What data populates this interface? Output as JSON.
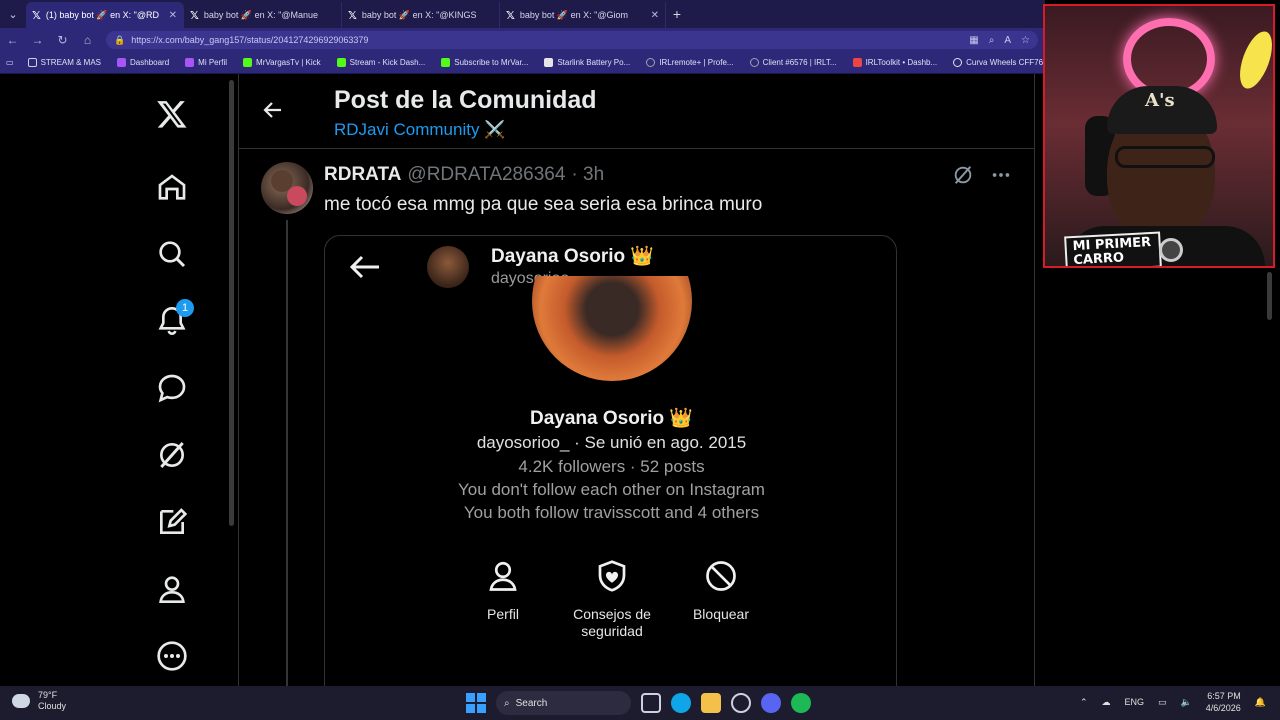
{
  "browser": {
    "tabs": [
      {
        "label": "(1) baby bot 🚀 en X: \"@RD",
        "active": true
      },
      {
        "label": "baby bot 🚀 en X: \"@Manue",
        "active": false
      },
      {
        "label": "baby bot 🚀 en X: \"@KINGS",
        "active": false
      },
      {
        "label": "baby bot 🚀 en X: \"@Giom",
        "active": false
      }
    ],
    "url": "https://x.com/baby_gang157/status/2041274296929063379",
    "bookmarks": [
      {
        "label": "STREAM & MAS",
        "color": "#cfcfe0"
      },
      {
        "label": "Dashboard",
        "color": "#a855f7"
      },
      {
        "label": "Mi Perfil",
        "color": "#a855f7"
      },
      {
        "label": "MrVargasTv | Kick",
        "color": "#53fc18"
      },
      {
        "label": "Stream - Kick Dash...",
        "color": "#53fc18"
      },
      {
        "label": "Subscribe to MrVar...",
        "color": "#53fc18"
      },
      {
        "label": "Starlink Battery Po...",
        "color": "#e5e5e5"
      },
      {
        "label": "IRLremote+ | Profe...",
        "color": "#9ca3af"
      },
      {
        "label": "Client #6576 | IRLT...",
        "color": "#9ca3af"
      },
      {
        "label": "IRLToolkit • Dashb...",
        "color": "#ef4444"
      },
      {
        "label": "Curva Wheels CFF76",
        "color": "#e5e5e5"
      }
    ]
  },
  "sidenav": {
    "notifications_count": "1"
  },
  "header": {
    "title": "Post de la Comunidad",
    "subtitle": "RDJavi Community ⚔️"
  },
  "post": {
    "name": "RDRATA",
    "handle": "@RDRATA286364",
    "time": "· 3h",
    "text": "me tocó esa mmg pa que sea seria esa brinca muro"
  },
  "embed": {
    "name": "Dayana Osorio 👑",
    "handle": "dayosorioo_",
    "profile_name": "Dayana Osorio 👑",
    "joined": "dayosorioo_ · Se unió en ago. 2015",
    "stats": "4.2K followers · 52 posts",
    "follow_status": "You don't follow each other on Instagram",
    "mutuals": "You both follow travisscott and 4 others",
    "actions": [
      {
        "label": "Perfil",
        "icon": "person-icon"
      },
      {
        "label": "Consejos de seguridad",
        "icon": "shield-icon"
      },
      {
        "label": "Bloquear",
        "icon": "block-icon"
      }
    ]
  },
  "webcam": {
    "sticker": "MI PRIMER CARRO",
    "cap_logo": "A's"
  },
  "taskbar": {
    "temperature": "79°F",
    "weather": "Cloudy",
    "search": "Search",
    "lang": "ENG",
    "time": "6:57 PM",
    "date": "4/6/2026"
  }
}
